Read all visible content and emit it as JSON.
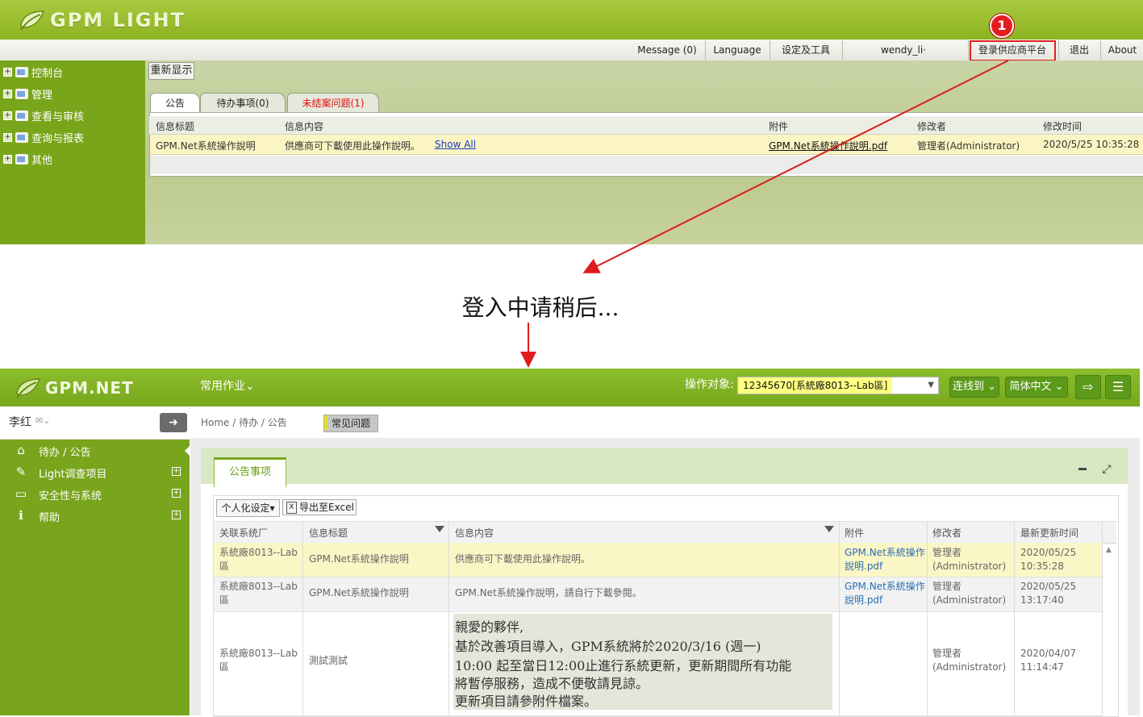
{
  "top": {
    "logo_text": "GPM LIGHT",
    "toolbar": {
      "message": "Message (0)",
      "language": "Language",
      "settings": "设定及工具",
      "user": "wendy_li·",
      "supplier_login": "登录供应商平台",
      "logout": "退出",
      "about": "About"
    },
    "callout_number": "1",
    "menu": [
      {
        "label": "控制台"
      },
      {
        "label": "管理"
      },
      {
        "label": "查看与审核"
      },
      {
        "label": "查询与报表"
      },
      {
        "label": "其他"
      }
    ],
    "refresh_label": "重新显示",
    "tabs": [
      {
        "label": "公告"
      },
      {
        "label": "待办事项(0)"
      },
      {
        "label": "未结案问题(1)"
      }
    ],
    "grid": {
      "headers": [
        "信息标题",
        "信息内容",
        "附件",
        "修改者",
        "修改时间"
      ],
      "row": {
        "title": "GPM.Net系統操作說明",
        "content": "供應商可下載使用此操作說明。",
        "show_all": "Show All",
        "attachment": "GPM.Net系統操作說明.pdf",
        "modifier": "管理者(Administrator)",
        "time": "2020/5/25 10:35:28"
      }
    }
  },
  "wait_text": "登入中请稍后...",
  "bottom": {
    "logo_text": "GPM.NET",
    "common_menu": "常用作业",
    "op_label": "操作对象:",
    "op_value": "12345670[系統廠8013--Lab區]",
    "connect_btn": "连线到",
    "lang_btn": "简体中文",
    "user_name": "李红",
    "sidebar": [
      {
        "label": "待办 / 公告",
        "icon": "home-icon"
      },
      {
        "label": "Light调查项目",
        "icon": "edit-icon"
      },
      {
        "label": "安全性与系统",
        "icon": "monitor-icon"
      },
      {
        "label": "帮助",
        "icon": "info-icon"
      }
    ],
    "breadcrumb": "Home /  待办 / 公告",
    "faq_btn": "常见问题",
    "panel_tab": "公告事项",
    "personal_btn": "个人化设定",
    "excel_btn": "导出至Excel",
    "grid_headers": [
      "关联系统厂",
      "信息标题",
      "信息内容",
      "附件",
      "修改者",
      "最新更新时间"
    ],
    "rows": [
      {
        "factory": "系統廠8013--Lab區",
        "title": "GPM.Net系統操作說明",
        "content": "供應商可下載使用此操作說明。",
        "attachment": "GPM.Net系統操作說明.pdf",
        "modifier": "管理者(Administrator)",
        "time": "2020/05/25 10:35:28"
      },
      {
        "factory": "系統廠8013--Lab區",
        "title": "GPM.Net系統操作說明",
        "content": "GPM.Net系統操作說明，請自行下載參閱。",
        "attachment": "GPM.Net系統操作說明.pdf",
        "modifier": "管理者(Administrator)",
        "time": "2020/05/25 13:17:40"
      },
      {
        "factory": "系統廠8013--Lab區",
        "title": "測試測試",
        "content_lines": [
          "親愛的夥伴,",
          "基於改善項目導入，GPM系統將於2020/3/16 (週一)",
          "10:00  起至當日12:00止進行系統更新，更新期間所有功能",
          "將暫停服務，造成不便敬請見諒。",
          "更新項目請參附件檔案。"
        ],
        "modifier": "管理者(Administrator)",
        "time": "2020/04/07 11:14:47"
      }
    ]
  }
}
